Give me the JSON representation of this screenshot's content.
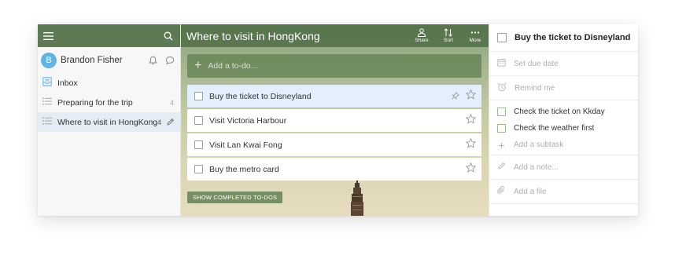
{
  "sidebar": {
    "user": {
      "initial": "B",
      "name": "Brandon Fisher"
    },
    "items": [
      {
        "label": "Inbox",
        "count": ""
      },
      {
        "label": "Preparing for the trip",
        "count": "4"
      },
      {
        "label": "Where to visit in HongKong",
        "count": "4"
      }
    ]
  },
  "main": {
    "title": "Where to visit in HongKong",
    "actions": {
      "share": "Share",
      "sort": "Sort",
      "more": "More"
    },
    "add_placeholder": "Add a to-do...",
    "tasks": [
      {
        "title": "Buy the ticket to Disneyland"
      },
      {
        "title": "Visit Victoria Harbour"
      },
      {
        "title": "Visit Lan Kwai Fong"
      },
      {
        "title": "Buy the metro card"
      }
    ],
    "show_completed": "SHOW COMPLETED TO-DOS"
  },
  "detail": {
    "title": "Buy the ticket to Disneyland",
    "due_date": "Set due date",
    "remind": "Remind me",
    "subtasks": [
      "Check the ticket on Kkday",
      "Check the weather first"
    ],
    "add_subtask": "Add a subtask",
    "note_placeholder": "Add a note...",
    "add_file": "Add a file"
  },
  "colors": {
    "header_green": "#5d7a54",
    "accent_blue": "#5fb4e4",
    "selected_row": "#e3effc",
    "subtask_green": "#9dbb84"
  }
}
